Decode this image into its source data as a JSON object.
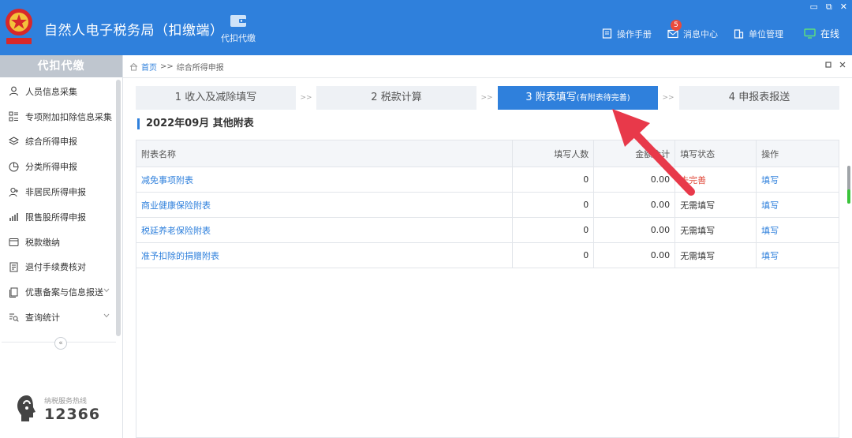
{
  "header": {
    "title": "自然人电子税务局（扣缴端）",
    "module_label": "代扣代缴",
    "window_controls": [
      "▭",
      "⧉",
      "✕"
    ],
    "actions": [
      {
        "label": "操作手册",
        "icon": "manual-icon"
      },
      {
        "label": "消息中心",
        "icon": "mail-icon",
        "badge": "5"
      },
      {
        "label": "单位管理",
        "icon": "building-icon"
      },
      {
        "label": "在线",
        "icon": "monitor-icon"
      }
    ]
  },
  "sidebar": {
    "title": "代扣代缴",
    "items": [
      {
        "label": "人员信息采集",
        "icon": "person-icon"
      },
      {
        "label": "专项附加扣除信息采集",
        "icon": "list-icon"
      },
      {
        "label": "综合所得申报",
        "icon": "layers-icon"
      },
      {
        "label": "分类所得申报",
        "icon": "pie-icon"
      },
      {
        "label": "非居民所得申报",
        "icon": "person-plus-icon"
      },
      {
        "label": "限售股所得申报",
        "icon": "bar-chart-icon"
      },
      {
        "label": "税款缴纳",
        "icon": "wallet-icon"
      },
      {
        "label": "退付手续费核对",
        "icon": "document-icon"
      },
      {
        "label": "优惠备案与信息报送",
        "icon": "doc-stack-icon"
      },
      {
        "label": "查询统计",
        "icon": "search-list-icon"
      }
    ],
    "collapse_symbol": "«",
    "hotline_label": "纳税服务热线",
    "hotline_number": "12366"
  },
  "breadcrumb": {
    "home": "首页",
    "sep": ">>",
    "current": "综合所得申报"
  },
  "steps": [
    {
      "label": "1 收入及减除填写"
    },
    {
      "label": "2 税款计算"
    },
    {
      "label": "3 附表填写",
      "note": "(有附表待完善)"
    },
    {
      "label": "4 申报表报送"
    }
  ],
  "step_sep": ">>",
  "section_title": "2022年09月  其他附表",
  "table": {
    "headers": [
      "附表名称",
      "填写人数",
      "金额合计",
      "填写状态",
      "操作"
    ],
    "rows": [
      {
        "name": "减免事项附表",
        "count": "0",
        "amount": "0.00",
        "status": "未完善",
        "op": "填写"
      },
      {
        "name": "商业健康保险附表",
        "count": "0",
        "amount": "0.00",
        "status": "无需填写",
        "op": "填写"
      },
      {
        "name": "税延养老保险附表",
        "count": "0",
        "amount": "0.00",
        "status": "无需填写",
        "op": "填写"
      },
      {
        "name": "准予扣除的捐赠附表",
        "count": "0",
        "amount": "0.00",
        "status": "无需填写",
        "op": "填写"
      }
    ]
  },
  "colors": {
    "accent": "#2f80dc",
    "warning": "#e04a3b",
    "pointer": "#e8394a"
  }
}
